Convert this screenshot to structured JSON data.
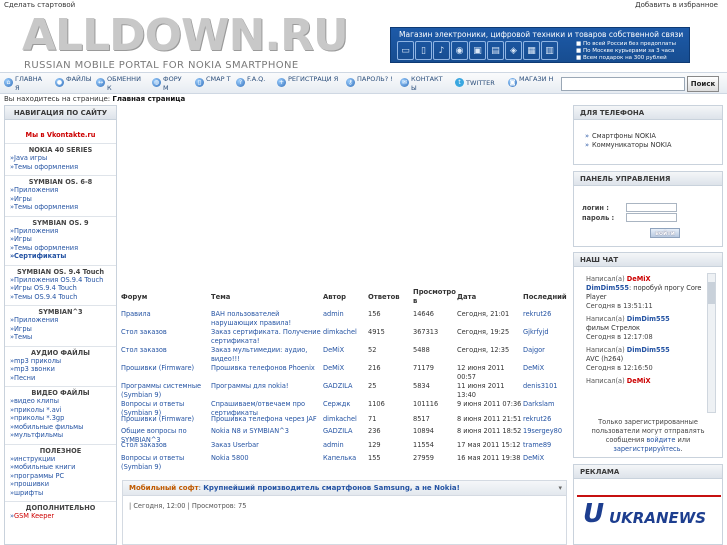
{
  "top": {
    "left_link": "Сделать стартовой",
    "right_link": "Добавить в избранное"
  },
  "logo": {
    "title": "ALLDOWN.RU",
    "subtitle": "RUSSIAN MOBILE PORTAL FOR NOKIA SMARTPHONE"
  },
  "banner": {
    "text": "Магазин электроники, цифровой техники и товаров собственной связи",
    "promo": [
      "■ По всей России без предоплаты",
      "■ По Москве курьерами за 3 часа",
      "■ Всем подарок на 300 рублей"
    ]
  },
  "nav": [
    {
      "label": "ГЛАВНА Я",
      "icon": "house-icon",
      "glyph": "⌂"
    },
    {
      "label": "ФАЙЛЫ",
      "icon": "disk-icon",
      "glyph": "●"
    },
    {
      "label": "ОБМЕННИ К",
      "icon": "exchange-icon",
      "glyph": "↔"
    },
    {
      "label": "ФОРУ М",
      "icon": "globe-icon",
      "glyph": "◍"
    },
    {
      "label": "СМАР Т",
      "icon": "phone-icon",
      "glyph": "▯"
    },
    {
      "label": "F.A.Q.",
      "icon": "help-icon",
      "glyph": "?"
    },
    {
      "label": "РЕГИСТРАЦИ Я",
      "icon": "register-icon",
      "glyph": "+"
    },
    {
      "label": "ПАРОЛЬ? !",
      "icon": "key-icon",
      "glyph": "⚷"
    },
    {
      "label": "КОНТАКТ Ы",
      "icon": "mail-icon",
      "glyph": "✉"
    },
    {
      "label": "TWITTER",
      "icon": "twitter-icon",
      "glyph": "t"
    },
    {
      "label": "МАГАЗИ Н",
      "icon": "shop-icon",
      "glyph": "◙"
    }
  ],
  "search": {
    "button": "Поиск",
    "placeholder": ""
  },
  "breadcrumb": {
    "prefix": "Вы находитесь на странице:",
    "current": "Главная страница"
  },
  "sidebar": {
    "title": "НАВИГАЦИЯ ПО САЙТУ",
    "vk": "Мы в Vkontakte.ru",
    "sections": [
      {
        "title": "NOKIA 40 SERIES",
        "links": [
          "Java игры",
          "Темы оформления"
        ]
      },
      {
        "title": "SYMBIAN OS. 6-8",
        "links": [
          "Приложения",
          "Игры",
          "Темы оформления"
        ]
      },
      {
        "title": "SYMBIAN OS. 9",
        "links": [
          "Приложения",
          "Игры",
          "Темы оформления",
          "Сертификаты"
        ]
      },
      {
        "title": "SYMBIAN OS. 9.4 Touch",
        "links": [
          "Приложения OS.9.4 Touch",
          "Игры OS.9.4 Touch",
          "Темы OS.9.4 Touch"
        ]
      },
      {
        "title": "SYMBIAN^3",
        "links": [
          "Приложения",
          "Игры",
          "Темы"
        ]
      },
      {
        "title": "АУДИО ФАЙЛЫ",
        "links": [
          "mp3 приколы",
          "mp3 звонки",
          "Песни"
        ]
      },
      {
        "title": "ВИДЕО ФАЙЛЫ",
        "links": [
          "видео клипы",
          "приколы *.avi",
          "приколы *.3gp",
          "мобильные фильмы",
          "мультфильмы"
        ]
      },
      {
        "title": "ПОЛЕЗНОЕ",
        "links": [
          "инструкции",
          "мобильные книги",
          "программы PC",
          "прошивки",
          "шрифты"
        ]
      },
      {
        "title": "ДОПОЛНИТЕЛЬНО",
        "links": [
          "GSM Keeper"
        ]
      }
    ]
  },
  "right": {
    "phones": {
      "title": "ДЛЯ ТЕЛЕФОНА",
      "links": [
        "Смартфоны NOKIA",
        "Коммуникаторы NOKIA"
      ]
    },
    "panel": {
      "title": "ПАНЕЛЬ УПРАВЛЕНИЯ",
      "login": "логин :",
      "password": "пароль :",
      "button": "войти"
    },
    "chat": {
      "title": "НАШ ЧАТ",
      "prefix": "Написал(а)",
      "messages": [
        {
          "nick": "DeMiX",
          "nick_red": true,
          "text_user": "DimDim555",
          "text": ": поробуй прогу Core Player",
          "time": "Сегодня в 13:51:11"
        },
        {
          "nick": "DimDim555",
          "nick_red": false,
          "text_user": "",
          "text": "фильм Стрелок",
          "time": "Сегодня в 12:17:08"
        },
        {
          "nick": "DimDim555",
          "nick_red": false,
          "text_user": "",
          "text": "AVC (h264)",
          "time": "Сегодня в 12:16:50"
        },
        {
          "nick": "DeMiX",
          "nick_red": true,
          "text_user": "",
          "text": "",
          "time": ""
        }
      ],
      "note1": "Только зарегистрированные пользователи могут отправлять сообщения",
      "note_login": "войдите",
      "note_or": "или",
      "note_reg": "зарегистрируйтесь",
      "note_end": "."
    },
    "ads": {
      "title": "РЕКЛАМА",
      "brand": "UKRANEWS"
    }
  },
  "forum": {
    "headers": [
      "Форум",
      "Тема",
      "Автор",
      "Ответов",
      "Просмотро в",
      "Дата",
      "Последний"
    ],
    "rows": [
      [
        "Правила",
        "ВАН пользователей нарушающих правила!",
        "admin",
        "156",
        "14646",
        "Сегодня, 21:01",
        "rekrut26"
      ],
      [
        "Стол заказов",
        "Заказ сертификата. Получение сертификата!",
        "dimkachel",
        "4915",
        "367313",
        "Сегодня, 19:25",
        "Gjkrfyjd"
      ],
      [
        "Стол заказов",
        "Заказ мультимедии: аудио, видео!!!",
        "DeMiX",
        "52",
        "5488",
        "Сегодня, 12:35",
        "Dajgor"
      ],
      [
        "Прошивки (Firmware)",
        "Прошивка телефонов Phoenix",
        "DeMiX",
        "216",
        "71179",
        "12 июня 2011 00:57",
        "DeMiX"
      ],
      [
        "Программы системные (Symbian 9)",
        "Программы для nokia!",
        "GADZILA",
        "25",
        "5834",
        "11 июня 2011 13:40",
        "denis3101"
      ],
      [
        "Вопросы и ответы (Symbian 9)",
        "Спрашиваем/отвечаем про сертификаты",
        "Серждк",
        "1106",
        "101116",
        "9 июня 2011 07:36",
        "Darkslam"
      ],
      [
        "Прошивки (Firmware)",
        "Прошивка телефона через JAF",
        "dimkachel",
        "71",
        "8517",
        "8 июня 2011 21:51",
        "rekrut26"
      ],
      [
        "Общие вопросы по SYMBIAN^3",
        "Nokia N8 и SYMBIAN^3",
        "GADZILA",
        "236",
        "10894",
        "8 июня 2011 18:52",
        "19sergey80"
      ],
      [
        "Стол заказов",
        "Заказ Userbar",
        "admin",
        "129",
        "11554",
        "17 мая 2011 15:12",
        "trame89"
      ],
      [
        "Вопросы и ответы (Symbian 9)",
        "Nokia 5800",
        "Капелька",
        "155",
        "27959",
        "16 мая 2011 19:38",
        "DeMiX"
      ]
    ]
  },
  "news": {
    "category": "Мобильный софт",
    "sep": ":",
    "title": "Крупнейший производитель смартфонов Samsung, а не Nokia!",
    "meta": "| Сегодня, 12:00 | Просмотров: 75"
  }
}
